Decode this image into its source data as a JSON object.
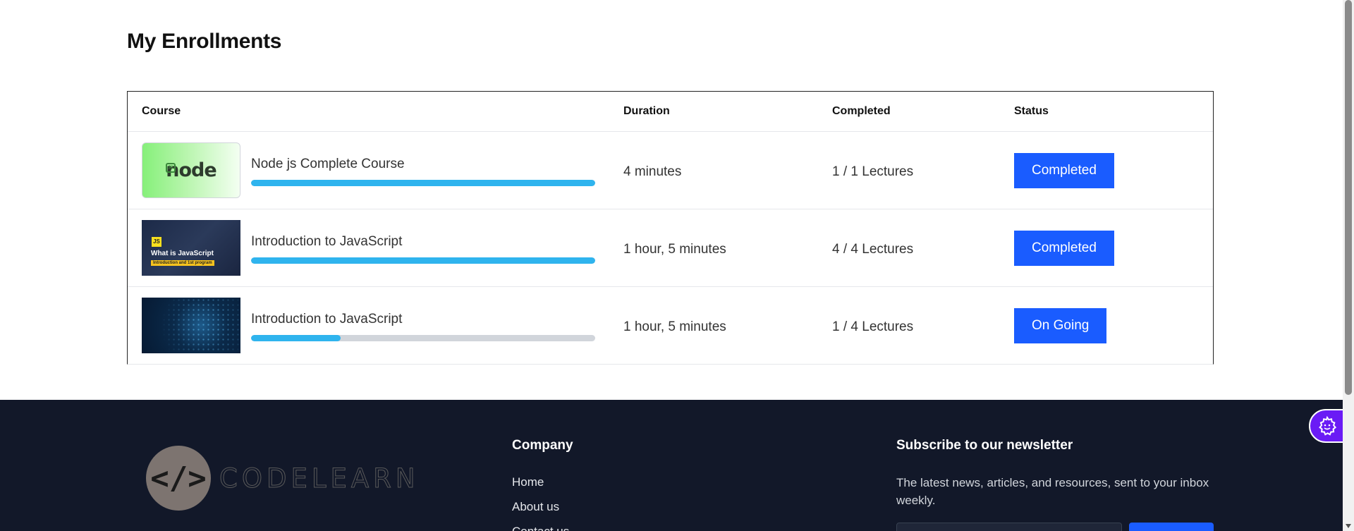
{
  "page": {
    "title": "My Enrollments"
  },
  "table": {
    "headers": {
      "course": "Course",
      "duration": "Duration",
      "completed": "Completed",
      "status": "Status"
    },
    "rows": [
      {
        "course": "Node js Complete Course",
        "thumbnail": "node-js-logo",
        "progress": 1.0,
        "duration": "4 minutes",
        "completed": "1 / 1 Lectures",
        "status": "Completed"
      },
      {
        "course": "Introduction to JavaScript",
        "thumbnail": "what-is-javascript",
        "progress": 1.0,
        "duration": "1 hour, 5 minutes",
        "completed": "4 / 4 Lectures",
        "status": "Completed"
      },
      {
        "course": "Introduction to JavaScript",
        "thumbnail": "abstract-tech",
        "progress": 0.26,
        "duration": "1 hour, 5 minutes",
        "completed": "1 / 4 Lectures",
        "status": "On Going"
      }
    ]
  },
  "thumbs": {
    "node_text": "node",
    "node_badge": "JS",
    "js_badge": "JS",
    "js_title": "What is JavaScript",
    "js_sub": "Introduction and 1st program"
  },
  "footer": {
    "logo_glyph": "</>",
    "logo_text": "CODELEARN",
    "company_heading": "Company",
    "links": [
      "Home",
      "About us",
      "Contact us"
    ],
    "newsletter_heading": "Subscribe to our newsletter",
    "newsletter_text": "The latest news, articles, and resources, sent to your inbox weekly."
  },
  "colors": {
    "accent": "#1a5cff",
    "progress": "#2fb4ee",
    "footer_bg": "#121829",
    "float": "#6a1bf5"
  },
  "icons": {
    "floating": "gear-face-icon"
  }
}
